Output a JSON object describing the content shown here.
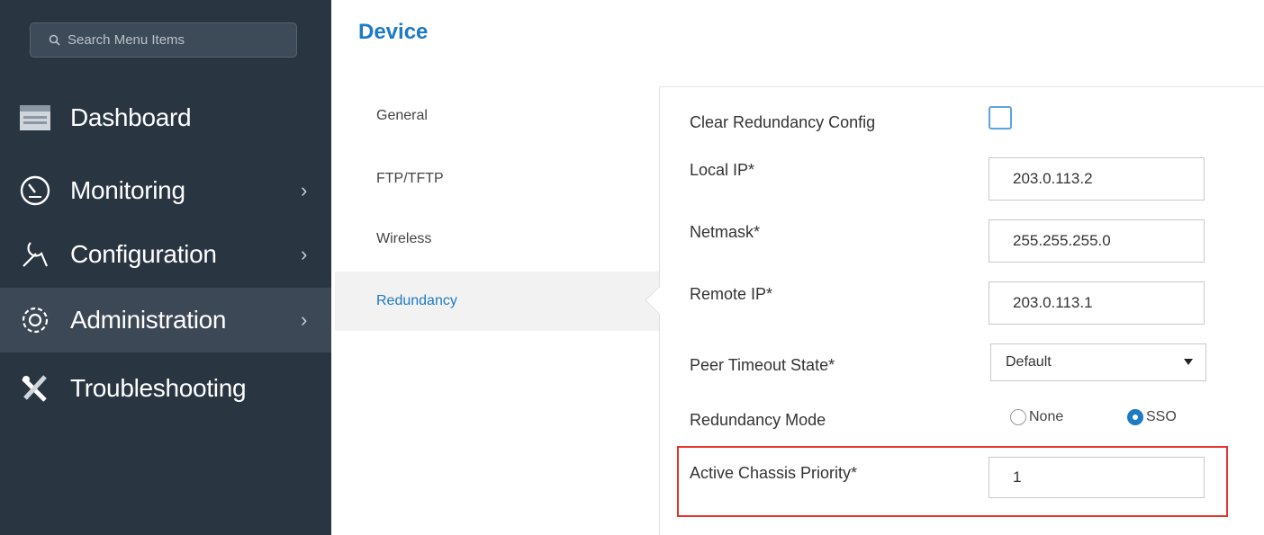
{
  "search": {
    "placeholder": "Search Menu Items"
  },
  "sidebar": {
    "items": [
      {
        "label": "Dashboard",
        "icon": "dashboard-icon",
        "chevron": ""
      },
      {
        "label": "Monitoring",
        "icon": "gauge-icon",
        "chevron": "›"
      },
      {
        "label": "Configuration",
        "icon": "wrench-icon",
        "chevron": "›"
      },
      {
        "label": "Administration",
        "icon": "gear-icon",
        "chevron": "›"
      },
      {
        "label": "Troubleshooting",
        "icon": "tools-icon",
        "chevron": ""
      }
    ],
    "active_index": 3
  },
  "page": {
    "title": "Device"
  },
  "tabs": [
    {
      "label": "General"
    },
    {
      "label": "FTP/TFTP"
    },
    {
      "label": "Wireless"
    },
    {
      "label": "Redundancy"
    }
  ],
  "active_tab": "Redundancy",
  "form": {
    "clear_config_label": "Clear Redundancy Config",
    "local_ip_label": "Local IP*",
    "local_ip_value": "203.0.113.2",
    "netmask_label": "Netmask*",
    "netmask_value": "255.255.255.0",
    "remote_ip_label": "Remote IP*",
    "remote_ip_value": "203.0.113.1",
    "peer_timeout_label": "Peer Timeout State*",
    "peer_timeout_value": "Default",
    "redundancy_mode_label": "Redundancy Mode",
    "mode_options": [
      {
        "label": "None",
        "checked": false
      },
      {
        "label": "SSO",
        "checked": true
      }
    ],
    "chassis_priority_label": "Active Chassis Priority*",
    "chassis_priority_value": "1"
  },
  "colors": {
    "sidebar_bg": "#2a3542",
    "accent": "#1d7ac4",
    "highlight": "#e5342a"
  }
}
